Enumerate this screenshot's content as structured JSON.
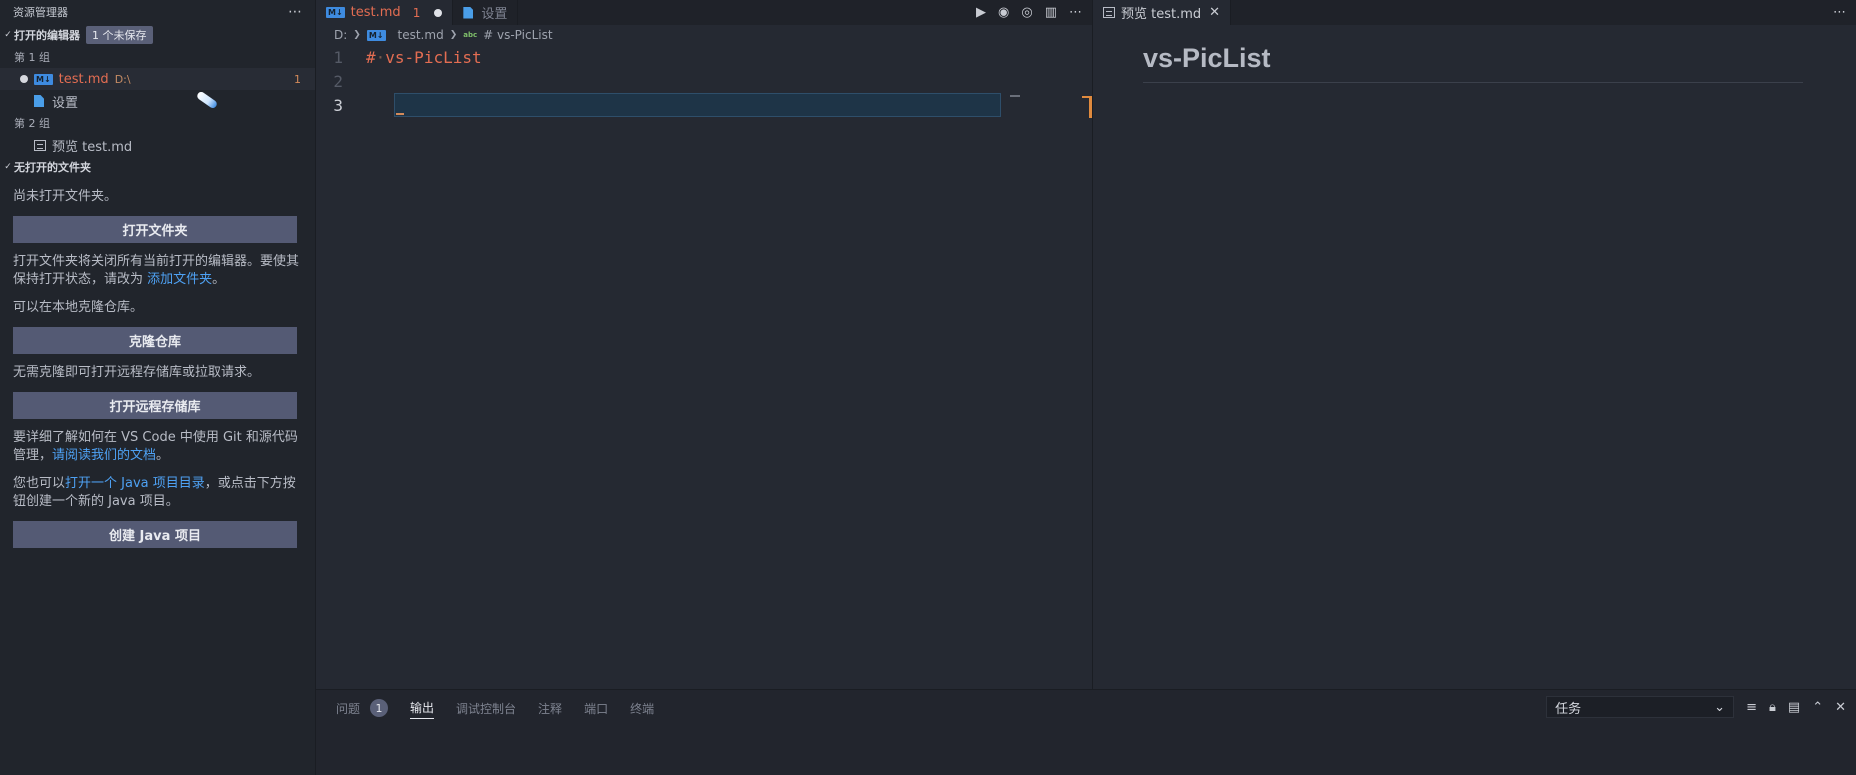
{
  "sidebar": {
    "title": "资源管理器",
    "more_icon": "⋯",
    "open_editors": {
      "label": "打开的编辑器",
      "unsaved_badge": "1 个未保存",
      "group1_label": "第 1 组",
      "group2_label": "第 2 组",
      "items": [
        {
          "name": "test.md",
          "path": "D:\\",
          "problems": "1",
          "icon": "markdown-icon"
        },
        {
          "name": "设置",
          "icon": "file-icon"
        },
        {
          "name": "预览 test.md",
          "icon": "preview-icon"
        }
      ]
    },
    "no_folder": {
      "label": "无打开的文件夹",
      "text1": "尚未打开文件夹。",
      "open_folder_button": "打开文件夹",
      "text2_a": "打开文件夹将关闭所有当前打开的编辑器。要使其保持打开状态，请改为 ",
      "text2_link": "添加文件夹",
      "text2_b": "。",
      "text3": "可以在本地克隆仓库。",
      "clone_button": "克隆仓库",
      "text4": "无需克隆即可打开远程存储库或拉取请求。",
      "open_remote_button": "打开远程存储库",
      "text5_a": "要详细了解如何在 VS Code 中使用 Git 和源代码管理，",
      "text5_link": "请阅读我们的文档",
      "text5_b": "。",
      "text6_a": "您也可以",
      "text6_link": "打开一个 Java 项目目录",
      "text6_b": "，或点击下方按钮创建一个新的 Java 项目。",
      "create_java_button": "创建 Java 项目"
    }
  },
  "editor1": {
    "tabs": [
      {
        "label": "test.md",
        "problems": "1",
        "modified": true
      },
      {
        "label": "设置"
      }
    ],
    "breadcrumb": {
      "drive": "D:",
      "file": "test.md",
      "symbol": "# vs-PicList",
      "symbol_icon": "abc"
    },
    "md_icon_text": "M↓",
    "lines": [
      {
        "number": "1",
        "hash": "#",
        "text": "vs-PicList"
      },
      {
        "number": "2",
        "text": ""
      },
      {
        "number": "3",
        "text": ""
      }
    ]
  },
  "editor2": {
    "tab_label": "预览 test.md",
    "heading": "vs-PicList"
  },
  "panel": {
    "tabs": [
      {
        "label": "问题",
        "badge": "1"
      },
      {
        "label": "输出",
        "active": true
      },
      {
        "label": "调试控制台"
      },
      {
        "label": "注释"
      },
      {
        "label": "端口"
      },
      {
        "label": "终端"
      }
    ],
    "task_select": "任务"
  }
}
